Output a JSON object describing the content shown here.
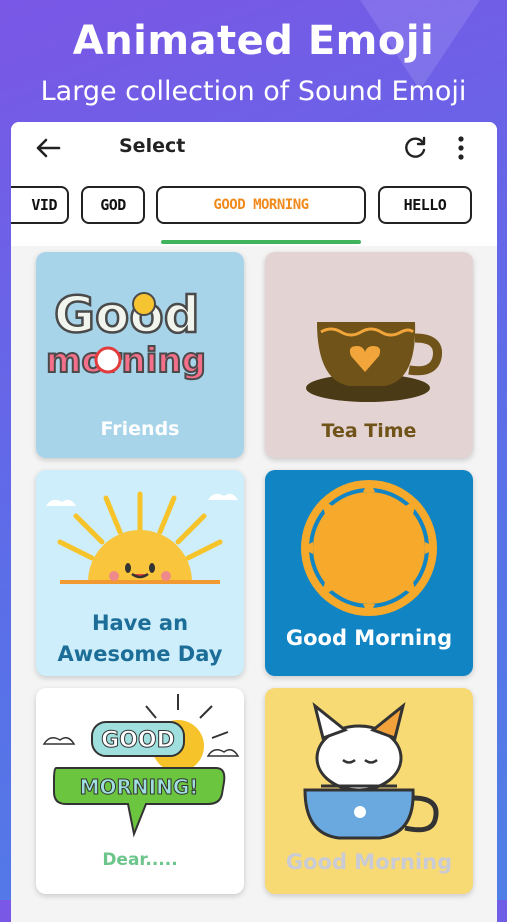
{
  "promo": {
    "title": "Animated Emoji",
    "subtitle": "Large collection of Sound Emoji"
  },
  "appbar": {
    "title": "Select",
    "back_icon": "arrow-left-icon",
    "refresh_icon": "refresh-icon",
    "more_icon": "more-vertical-icon"
  },
  "categories": {
    "items": [
      {
        "label": "VID"
      },
      {
        "label": "GOD"
      },
      {
        "label": "GOOD MORNING"
      },
      {
        "label": "HELLO"
      }
    ],
    "selected": "GOOD MORNING",
    "accent_color": "#f08a1c",
    "indicator_color": "#3fb45c"
  },
  "stickers": [
    {
      "caption": "Friends",
      "art_text": [
        "Good",
        "morning"
      ],
      "bg": "#a8d4ea"
    },
    {
      "caption": "Tea Time",
      "bg": "#e3d3d3"
    },
    {
      "caption": "Have an Awesome Day",
      "bg": "#cdeefa"
    },
    {
      "caption": "Good Morning",
      "bg": "#1185c4"
    },
    {
      "caption": "Dear.....",
      "art_text": [
        "GOOD",
        "MORNING!"
      ],
      "bg": "#ffffff"
    },
    {
      "caption": "Good Morning",
      "bg": "#f8da74"
    }
  ]
}
